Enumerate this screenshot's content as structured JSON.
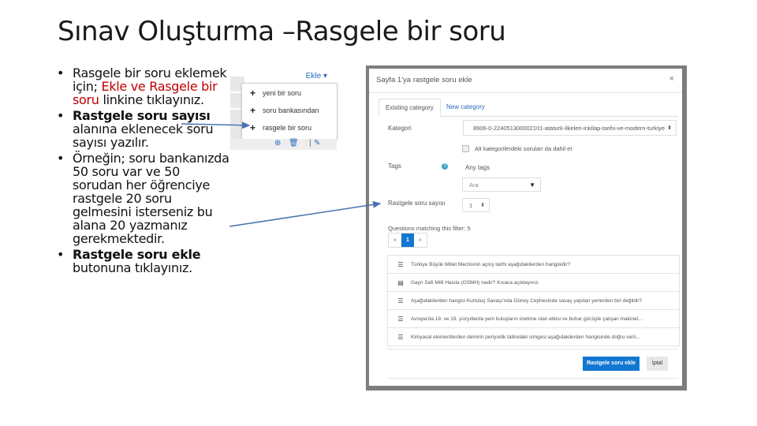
{
  "slide": {
    "title": "Sınav Oluşturma –Rasgele bir soru"
  },
  "bullets": [
    {
      "parts": [
        {
          "text": "Rasgele bir soru eklemek için; ",
          "style": "normal"
        },
        {
          "text": "Ekle ve Rasgele bir soru",
          "style": "red"
        },
        {
          "text": " linkine tıklayınız.",
          "style": "normal"
        }
      ]
    },
    {
      "parts": [
        {
          "text": "Rastgele soru sayısı",
          "style": "bold"
        },
        {
          "text": " alanına eklenecek soru sayısı yazılır.",
          "style": "normal"
        }
      ]
    },
    {
      "parts": [
        {
          "text": "Örneğin; soru bankanızda 50 soru var ve 50 sorudan her öğrenciye rastgele 20 soru gelmesini isterseniz bu alana 20 yazmanız gerekmektedir.",
          "style": "normal"
        }
      ]
    },
    {
      "parts": [
        {
          "text": "Rastgele soru ekle",
          "style": "bold"
        },
        {
          "text": " butonuna tıklayınız.",
          "style": "normal"
        }
      ]
    }
  ],
  "ekle_menu": {
    "label": "Ekle ▾",
    "items": [
      {
        "icon": "plus-icon",
        "label": "yeni bir soru"
      },
      {
        "icon": "plus-icon",
        "label": "soru bankasından"
      },
      {
        "icon": "plus-icon",
        "label": "rasgele bir soru"
      }
    ],
    "bottom_icons": [
      "zoom-icon",
      "trash-icon",
      "edit-icon"
    ]
  },
  "modal": {
    "title": "Sayfa 1'ya rastgele soru ekle",
    "close": "×",
    "tabs": [
      {
        "label": "Existing category",
        "active": true
      },
      {
        "label": "New category",
        "active": false
      }
    ],
    "kategori_label": "Kategori",
    "kategori_value": "8906-0-224051300002101-ataturk-ilkeleri-inkilap-tarihi-ve-modern-turkiye",
    "subcat_checkbox": "Alt kategorilerdeki soruları da dahil et",
    "tags_label": "Tags",
    "tags_value": "Any tags",
    "tags_search_placeholder": "Ara",
    "count_label": "Rastgele soru sayısı",
    "count_value": "1",
    "matching_text": "Questions matching this filter: 5",
    "pager": {
      "prev": "«",
      "current": "1",
      "next": "»"
    },
    "questions": [
      {
        "type": "multichoice",
        "text": "Türkiye Büyük Millet Meclisinin açılış tarihi aşağıdakilerden hangisidir?"
      },
      {
        "type": "essay",
        "text": "Gayri Safi Milli Hasıla (GSMH) nedir? Kısaca açıklayınız."
      },
      {
        "type": "multichoice",
        "text": "Aşağıdakilerden hangisi Kurtuluş Savaşı'nda Güney Cephesinde savaş yapılan yerlerden biri değildir?"
      },
      {
        "type": "multichoice",
        "text": "Avrupa'da 18. ve 19. yüzyıllarda yeni buluşların üretime olan etkisi ve buhar gücüyle çalışan makinel..."
      },
      {
        "type": "multichoice",
        "text": "Kimyasal elementlerden demirin periyodik tablodaki simgesi aşağıdakilerden hangisinde doğru veril..."
      }
    ],
    "primary_button": "Rastgele soru ekle",
    "cancel_button": "İptal"
  },
  "colors": {
    "accent_blue": "#1177d1",
    "link_blue": "#2a6ebb",
    "red_text": "#c00000",
    "arrow": "#4a72b0"
  }
}
